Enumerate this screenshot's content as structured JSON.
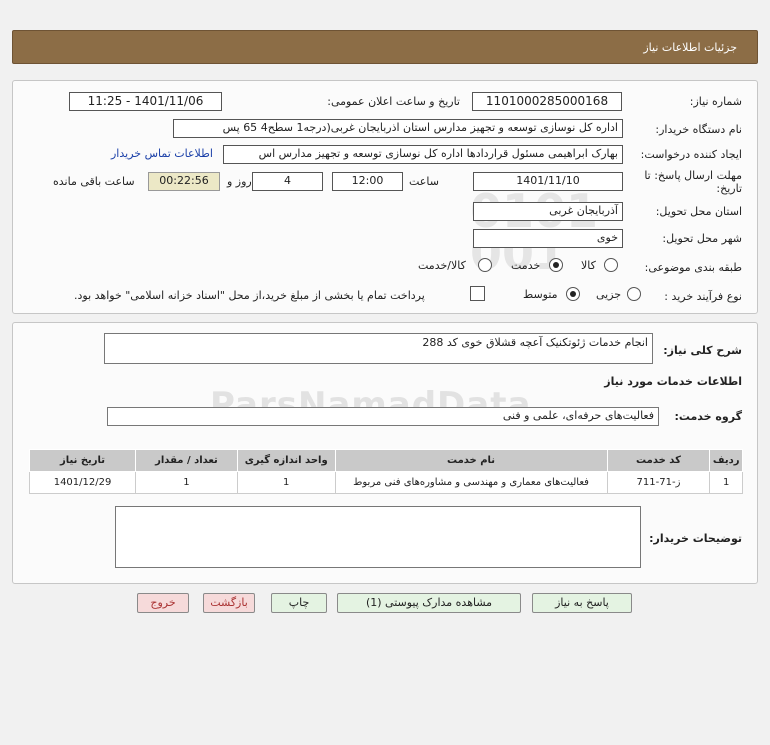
{
  "header": {
    "title": "جزئیات اطلاعات نیاز"
  },
  "form": {
    "need_number_label": "شماره نیاز:",
    "need_number": "1101000285000168",
    "announce_label": "تاریخ و ساعت اعلان عمومی:",
    "announce_value": "1401/11/06 - 11:25",
    "buyer_org_label": "نام دستگاه خریدار:",
    "buyer_org": "اداره کل نوسازی   توسعه و تجهیز مدارس استان اذربایجان غربی(درجه1  سطح4  65 پس",
    "requester_label": "ایجاد کننده درخواست:",
    "requester": "بهارک ابراهیمی مسئول قراردادها اداره کل نوسازی   توسعه و تجهیز مدارس اس",
    "buyer_contact_link": "اطلاعات تماس خریدار",
    "deadline_label_1": "مهلت ارسال پاسخ: تا",
    "deadline_label_2": "تاریخ:",
    "deadline_date": "1401/11/10",
    "time_label": "ساعت",
    "deadline_time": "12:00",
    "days_value": "4",
    "days_label": "روز و",
    "remaining_time": "00:22:56",
    "remaining_label": "ساعت باقی مانده",
    "province_label": "استان محل تحویل:",
    "province": "آذربایجان غربی",
    "city_label": "شهر محل تحویل:",
    "city": "خوی",
    "category_label": "طبقه بندی موضوعی:",
    "category_options": [
      "کالا",
      "خدمت",
      "کالا/خدمت"
    ],
    "category_selected": "خدمت",
    "process_label": "نوع فرآیند خرید :",
    "process_options": [
      "جزیی",
      "متوسط"
    ],
    "process_selected": "متوسط",
    "payment_note": "پرداخت تمام یا بخشی از مبلغ خرید،از محل \"اسناد خزانه اسلامی\" خواهد بود."
  },
  "need": {
    "summary_label": "شرح کلی نیاز:",
    "summary": "انجام خدمات ژئوتکنیک آعچه قشلاق خوی کد 288",
    "services_title": "اطلاعات خدمات مورد نیاز",
    "service_group_label": "گروه خدمت:",
    "service_group": "فعالیت‌های حرفه‌ای، علمی و فنی"
  },
  "table": {
    "headers": [
      "ردیف",
      "کد خدمت",
      "نام خدمت",
      "واحد اندازه گیری",
      "تعداد / مقدار",
      "تاریخ نیاز"
    ],
    "rows": [
      [
        "1",
        "ز-71-711",
        "فعالیت‌های معماری و مهندسی و مشاوره‌های فنی مربوط",
        "1",
        "1",
        "1401/12/29"
      ]
    ]
  },
  "buyer_notes_label": "توضیحات خریدار:",
  "buyer_notes": "",
  "buttons": {
    "reply": "پاسخ به نیاز",
    "attachments": "مشاهده مدارک پیوستی (1)",
    "print": "چاپ",
    "back": "بازگشت",
    "exit": "خروج"
  }
}
